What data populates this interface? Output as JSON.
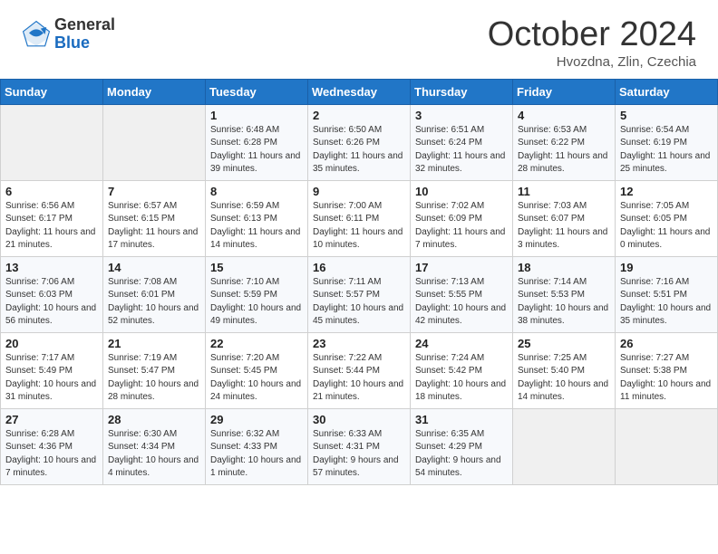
{
  "header": {
    "logo_general": "General",
    "logo_blue": "Blue",
    "title": "October 2024",
    "subtitle": "Hvozdna, Zlin, Czechia"
  },
  "calendar": {
    "days_of_week": [
      "Sunday",
      "Monday",
      "Tuesday",
      "Wednesday",
      "Thursday",
      "Friday",
      "Saturday"
    ],
    "weeks": [
      [
        {
          "day": "",
          "info": ""
        },
        {
          "day": "",
          "info": ""
        },
        {
          "day": "1",
          "info": "Sunrise: 6:48 AM\nSunset: 6:28 PM\nDaylight: 11 hours and 39 minutes."
        },
        {
          "day": "2",
          "info": "Sunrise: 6:50 AM\nSunset: 6:26 PM\nDaylight: 11 hours and 35 minutes."
        },
        {
          "day": "3",
          "info": "Sunrise: 6:51 AM\nSunset: 6:24 PM\nDaylight: 11 hours and 32 minutes."
        },
        {
          "day": "4",
          "info": "Sunrise: 6:53 AM\nSunset: 6:22 PM\nDaylight: 11 hours and 28 minutes."
        },
        {
          "day": "5",
          "info": "Sunrise: 6:54 AM\nSunset: 6:19 PM\nDaylight: 11 hours and 25 minutes."
        }
      ],
      [
        {
          "day": "6",
          "info": "Sunrise: 6:56 AM\nSunset: 6:17 PM\nDaylight: 11 hours and 21 minutes."
        },
        {
          "day": "7",
          "info": "Sunrise: 6:57 AM\nSunset: 6:15 PM\nDaylight: 11 hours and 17 minutes."
        },
        {
          "day": "8",
          "info": "Sunrise: 6:59 AM\nSunset: 6:13 PM\nDaylight: 11 hours and 14 minutes."
        },
        {
          "day": "9",
          "info": "Sunrise: 7:00 AM\nSunset: 6:11 PM\nDaylight: 11 hours and 10 minutes."
        },
        {
          "day": "10",
          "info": "Sunrise: 7:02 AM\nSunset: 6:09 PM\nDaylight: 11 hours and 7 minutes."
        },
        {
          "day": "11",
          "info": "Sunrise: 7:03 AM\nSunset: 6:07 PM\nDaylight: 11 hours and 3 minutes."
        },
        {
          "day": "12",
          "info": "Sunrise: 7:05 AM\nSunset: 6:05 PM\nDaylight: 11 hours and 0 minutes."
        }
      ],
      [
        {
          "day": "13",
          "info": "Sunrise: 7:06 AM\nSunset: 6:03 PM\nDaylight: 10 hours and 56 minutes."
        },
        {
          "day": "14",
          "info": "Sunrise: 7:08 AM\nSunset: 6:01 PM\nDaylight: 10 hours and 52 minutes."
        },
        {
          "day": "15",
          "info": "Sunrise: 7:10 AM\nSunset: 5:59 PM\nDaylight: 10 hours and 49 minutes."
        },
        {
          "day": "16",
          "info": "Sunrise: 7:11 AM\nSunset: 5:57 PM\nDaylight: 10 hours and 45 minutes."
        },
        {
          "day": "17",
          "info": "Sunrise: 7:13 AM\nSunset: 5:55 PM\nDaylight: 10 hours and 42 minutes."
        },
        {
          "day": "18",
          "info": "Sunrise: 7:14 AM\nSunset: 5:53 PM\nDaylight: 10 hours and 38 minutes."
        },
        {
          "day": "19",
          "info": "Sunrise: 7:16 AM\nSunset: 5:51 PM\nDaylight: 10 hours and 35 minutes."
        }
      ],
      [
        {
          "day": "20",
          "info": "Sunrise: 7:17 AM\nSunset: 5:49 PM\nDaylight: 10 hours and 31 minutes."
        },
        {
          "day": "21",
          "info": "Sunrise: 7:19 AM\nSunset: 5:47 PM\nDaylight: 10 hours and 28 minutes."
        },
        {
          "day": "22",
          "info": "Sunrise: 7:20 AM\nSunset: 5:45 PM\nDaylight: 10 hours and 24 minutes."
        },
        {
          "day": "23",
          "info": "Sunrise: 7:22 AM\nSunset: 5:44 PM\nDaylight: 10 hours and 21 minutes."
        },
        {
          "day": "24",
          "info": "Sunrise: 7:24 AM\nSunset: 5:42 PM\nDaylight: 10 hours and 18 minutes."
        },
        {
          "day": "25",
          "info": "Sunrise: 7:25 AM\nSunset: 5:40 PM\nDaylight: 10 hours and 14 minutes."
        },
        {
          "day": "26",
          "info": "Sunrise: 7:27 AM\nSunset: 5:38 PM\nDaylight: 10 hours and 11 minutes."
        }
      ],
      [
        {
          "day": "27",
          "info": "Sunrise: 6:28 AM\nSunset: 4:36 PM\nDaylight: 10 hours and 7 minutes."
        },
        {
          "day": "28",
          "info": "Sunrise: 6:30 AM\nSunset: 4:34 PM\nDaylight: 10 hours and 4 minutes."
        },
        {
          "day": "29",
          "info": "Sunrise: 6:32 AM\nSunset: 4:33 PM\nDaylight: 10 hours and 1 minute."
        },
        {
          "day": "30",
          "info": "Sunrise: 6:33 AM\nSunset: 4:31 PM\nDaylight: 9 hours and 57 minutes."
        },
        {
          "day": "31",
          "info": "Sunrise: 6:35 AM\nSunset: 4:29 PM\nDaylight: 9 hours and 54 minutes."
        },
        {
          "day": "",
          "info": ""
        },
        {
          "day": "",
          "info": ""
        }
      ]
    ]
  }
}
